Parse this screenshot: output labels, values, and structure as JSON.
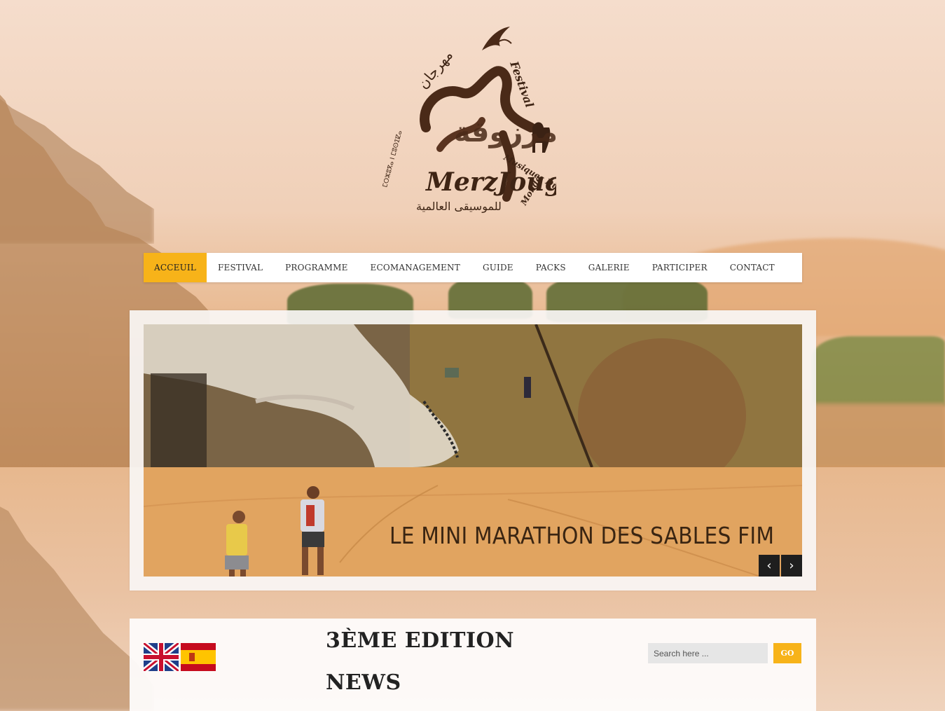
{
  "logo": {
    "arabic_title": "مرزوقة",
    "latin_title": "MerzJouga",
    "festival": "Festival",
    "musiques": "Musiques Du",
    "monde": "Monde",
    "arabic_sub": "مهرجان",
    "arabic_bottom": "للموسيقى العالمية",
    "tifinagh": "ⵎⵔⵣⵓⴳⴰ ⵏ ⵎⵓⵙⵉⵇⴰ"
  },
  "nav": {
    "items": [
      "ACCEUIL",
      "FESTIVAL",
      "PROGRAMME",
      "ECOMANAGEMENT",
      "GUIDE",
      "PACKS",
      "GALERIE",
      "PARTICIPER",
      "CONTACT"
    ],
    "active": "ACCEUIL",
    "accent_color": "#f7b319"
  },
  "slider": {
    "caption": "LE MINI MARATHON DES SABLES FIM",
    "prev_icon": "chevron-left-icon",
    "next_icon": "chevron-right-icon"
  },
  "languages": [
    {
      "code": "en",
      "icon": "uk-flag-icon"
    },
    {
      "code": "es",
      "icon": "spain-flag-icon"
    }
  ],
  "content": {
    "edition_heading": "3ÈME EDITION",
    "news_heading": "NEWS"
  },
  "search": {
    "placeholder": "Search here ...",
    "button_label": "GO"
  }
}
